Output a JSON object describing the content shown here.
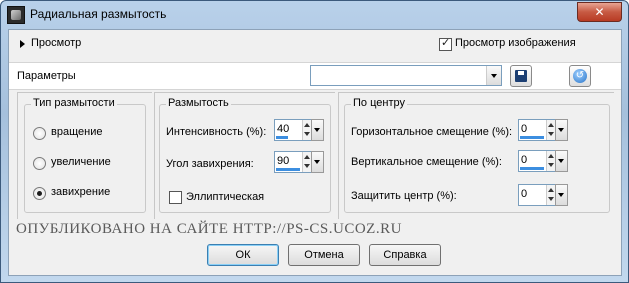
{
  "window": {
    "title": "Радиальная размытость",
    "close_label": "✕"
  },
  "preview": {
    "label": "Просмотр",
    "image_preview_label": "Просмотр изображения",
    "image_preview_checked": true
  },
  "params": {
    "label": "Параметры",
    "preset_value": ""
  },
  "blur_type": {
    "title": "Тип размытости",
    "options": [
      {
        "label": "вращение",
        "selected": false
      },
      {
        "label": "увеличение",
        "selected": false
      },
      {
        "label": "завихрение",
        "selected": true
      }
    ]
  },
  "blur": {
    "title": "Размытость",
    "intensity_label": "Интенсивность (%):",
    "intensity_value": "40",
    "twist_label": "Угол завихрения:",
    "twist_value": "90",
    "elliptical_label": "Эллиптическая",
    "elliptical_checked": false
  },
  "center": {
    "title": "По центру",
    "h_offset_label": "Горизонтальное смещение (%):",
    "h_offset_value": "0",
    "v_offset_label": "Вертикальное смещение (%):",
    "v_offset_value": "0",
    "protect_label": "Защитить центр (%):",
    "protect_value": "0"
  },
  "watermark": "ОПУБЛИКОВАНО   НА САЙТЕ   HTTP://PS-CS.UCOZ.RU",
  "buttons": {
    "ok": "ОК",
    "cancel": "Отмена",
    "help": "Справка"
  },
  "colors": {
    "accent": "#3c8ee0",
    "close": "#c75a43"
  }
}
